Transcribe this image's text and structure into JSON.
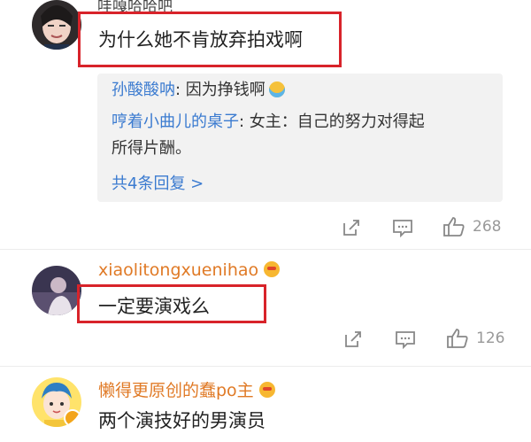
{
  "comments": [
    {
      "username": "哇嘎哈哈吧",
      "text": "为什么她不肯放弃拍戏啊",
      "replies": [
        {
          "name": "孙酸酸呐",
          "text": ": 因为挣钱啊"
        },
        {
          "name": "哼着小曲儿的桌子",
          "text": ": 女主：自己的努力对得起",
          "text2": "所得片酬。"
        }
      ],
      "more_label": "共4条回复 >",
      "likes": "268"
    },
    {
      "username": "xiaolitongxuenihao",
      "text": "一定要演戏么",
      "likes": "126"
    },
    {
      "username": "懒得更原创的蠢po主",
      "text": "两个演技好的男演员"
    }
  ],
  "colors": {
    "highlight": "#d8232a",
    "username": "#e07a26",
    "reply_name": "#3b7bd0",
    "reply_bg": "#f2f2f2"
  },
  "icons": [
    "share-icon",
    "comment-icon",
    "like-icon",
    "vip-badge-icon",
    "emoji-icon"
  ]
}
